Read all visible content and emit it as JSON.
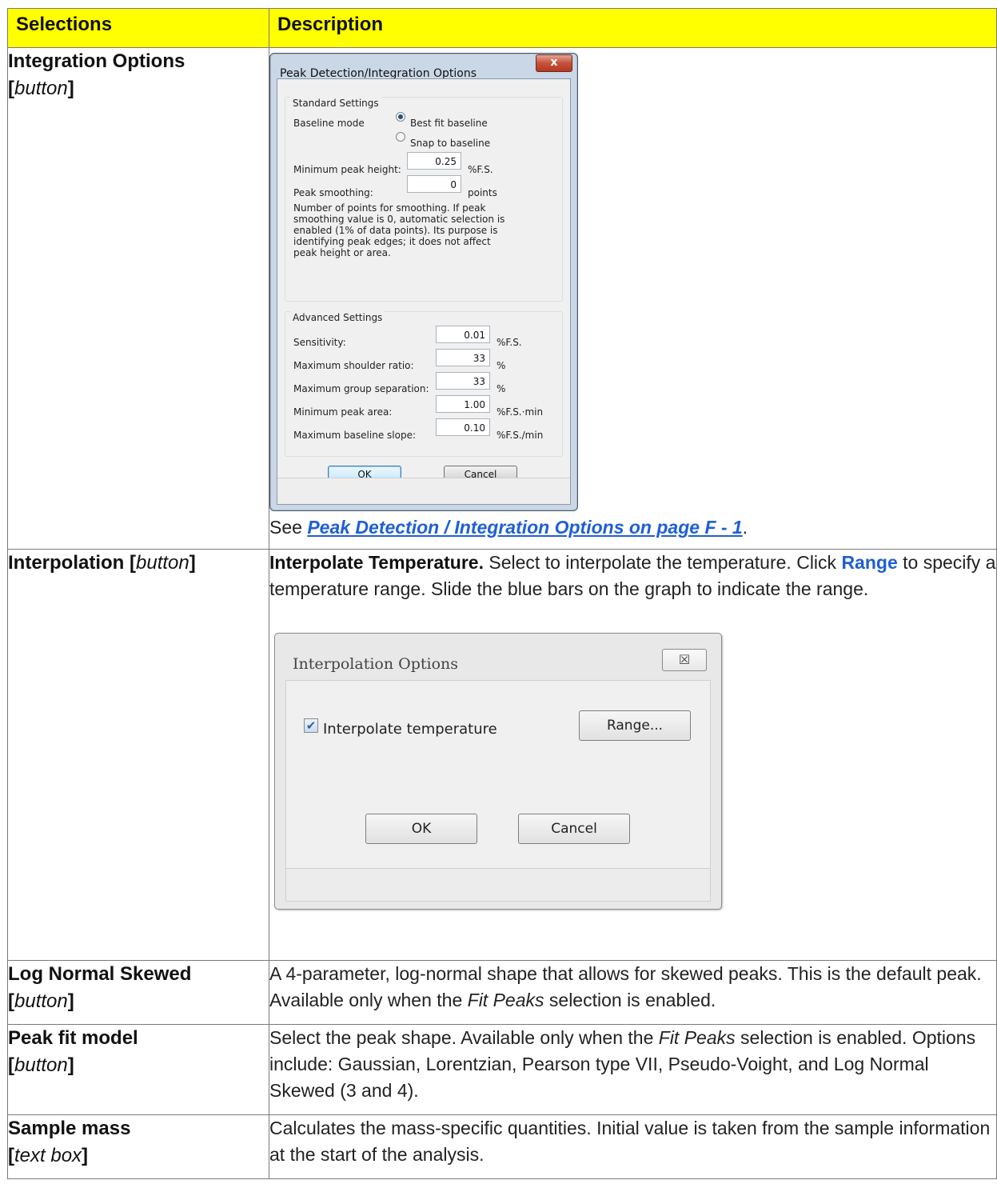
{
  "table": {
    "headers": [
      "Selections",
      "Description"
    ],
    "rows": [
      {
        "sel_name": "Integration Options",
        "sel_type": "button",
        "see_prefix": "See ",
        "see_link": "Peak Detection / Integration Options on page F - 1",
        "see_suffix": "."
      },
      {
        "sel_name": "Interpolation",
        "sel_type": "button",
        "desc_bold": "Interpolate Temperature.",
        "desc_a": " Select to interpolate the temperature. Click ",
        "desc_btn": "Range",
        "desc_b": " to specify a temperature range. Slide the blue bars on the graph to indicate the range."
      },
      {
        "sel_name": "Log Normal Skewed",
        "sel_type": "button",
        "desc_a": "A 4-parameter, log-normal shape that allows for skewed peaks. This is the default peak. Available only when the ",
        "desc_i": "Fit Peaks",
        "desc_b": " selection is enabled."
      },
      {
        "sel_name": "Peak fit model",
        "sel_type": "button",
        "desc_a": "Select the peak shape. Available only when the ",
        "desc_i": "Fit Peaks",
        "desc_b": " selection is enabled. Options include: Gaussian, Lorentzian, Pearson type VII, Pseudo-Voight, and Log Normal Skewed (3 and 4)."
      },
      {
        "sel_name": "Sample mass",
        "sel_type": "text box",
        "desc_a": "Calculates the mass-specific quantities. Initial value is taken from the sample information at the start of the analysis."
      }
    ]
  },
  "dialog_integration": {
    "title": "Peak Detection/Integration Options",
    "close": "x",
    "standard_group": "Standard Settings",
    "baseline_mode_label": "Baseline mode",
    "radio_best_fit": "Best fit baseline",
    "radio_snap": "Snap to baseline",
    "min_peak_height_label": "Minimum peak height:",
    "min_peak_height_value": "0.25",
    "min_peak_height_unit": "%F.S.",
    "peak_smoothing_label": "Peak smoothing:",
    "peak_smoothing_value": "0",
    "peak_smoothing_unit": "points",
    "note": "Number of points for smoothing. If peak smoothing value is 0, automatic selection is enabled (1% of data points). Its purpose is identifying peak edges; it does not affect peak height or area.",
    "advanced_group": "Advanced Settings",
    "advanced": [
      {
        "label": "Sensitivity:",
        "value": "0.01",
        "unit": "%F.S."
      },
      {
        "label": "Maximum shoulder ratio:",
        "value": "33",
        "unit": "%"
      },
      {
        "label": "Maximum group separation:",
        "value": "33",
        "unit": "%"
      },
      {
        "label": "Minimum peak area:",
        "value": "1.00",
        "unit": "%F.S.·min"
      },
      {
        "label": "Maximum baseline slope:",
        "value": "0.10",
        "unit": "%F.S./min"
      }
    ],
    "ok": "OK",
    "cancel": "Cancel"
  },
  "dialog_interpolation": {
    "title": "Interpolation Options",
    "close": "☒",
    "checkbox_label": "Interpolate temperature",
    "checkbox_checked": true,
    "range_button": "Range...",
    "ok": "OK",
    "cancel": "Cancel"
  }
}
